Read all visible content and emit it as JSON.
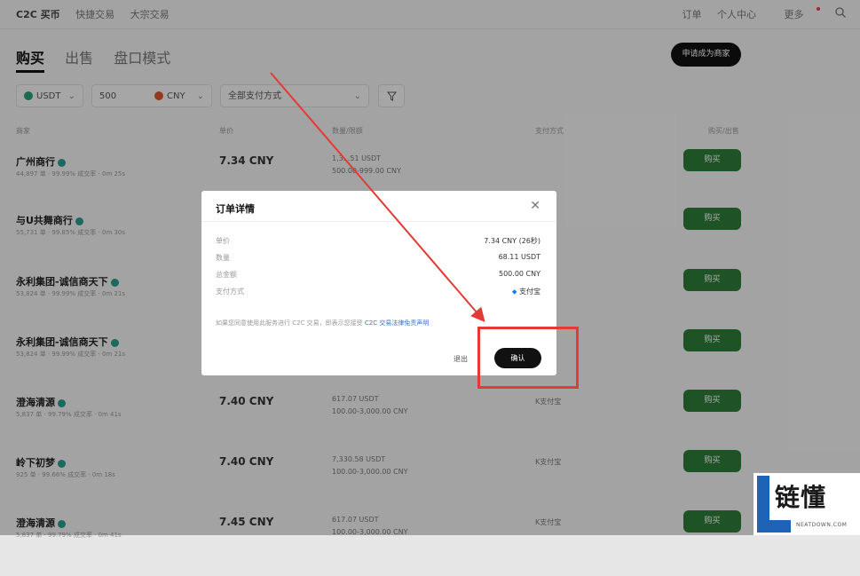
{
  "nav": {
    "brand": "C2C 买币",
    "items": [
      "快捷交易",
      "大宗交易"
    ],
    "right": [
      "订单",
      "个人中心",
      "更多"
    ]
  },
  "tabs": [
    "购买",
    "出售",
    "盘口模式"
  ],
  "merchant_button": "申请成为商家",
  "filters": {
    "coin": "USDT",
    "amount": "500",
    "fiat": "CNY",
    "payment": "全部支付方式"
  },
  "headers": [
    "商家",
    "单价",
    "数量/限额",
    "支付方式",
    "购买/出售"
  ],
  "rows": [
    {
      "name": "广州商行",
      "stats": "44,897 单 · 99.99% 成交率 · 0m 25s",
      "price": "7.34 CNY",
      "qty": "1,3...51 USDT",
      "limit": "500.00-999.00 CNY",
      "pay": "",
      "buy": "购买"
    },
    {
      "name": "与U共舞商行",
      "stats": "55,731 单 · 99.85% 成交率 · 0m 30s",
      "price": "",
      "qty": "",
      "limit": "",
      "pay": "",
      "buy": "购买"
    },
    {
      "name": "永利集团-诚信商天下",
      "stats": "53,824 单 · 99.99% 成交率 · 0m 21s",
      "price": "",
      "qty": "",
      "limit": "",
      "pay": "",
      "buy": "购买"
    },
    {
      "name": "永利集团-诚信商天下",
      "stats": "53,824 单 · 99.99% 成交率 · 0m 21s",
      "price": "",
      "qty": "",
      "limit": "",
      "pay": "",
      "buy": "购买"
    },
    {
      "name": "澄海清源",
      "stats": "5,837 单 · 99.79% 成交率 · 0m 41s",
      "price": "7.40 CNY",
      "qty": "617.07 USDT",
      "limit": "100.00-3,000.00 CNY",
      "pay": "K支付宝",
      "buy": "购买"
    },
    {
      "name": "岭下初梦",
      "stats": "925 单 · 99.66% 成交率 · 0m 18s",
      "price": "7.40 CNY",
      "qty": "7,330.58 USDT",
      "limit": "100.00-3,000.00 CNY",
      "pay": "K支付宝",
      "buy": "购买"
    },
    {
      "name": "澄海清源",
      "stats": "5,837 单 · 99.79% 成交率 · 0m 41s",
      "price": "7.45 CNY",
      "qty": "617.07 USDT",
      "limit": "100.00-3,000.00 CNY",
      "pay": "K支付宝",
      "buy": "购买"
    }
  ],
  "dialog": {
    "title": "订单详情",
    "labels": [
      "单价",
      "数量",
      "总金额",
      "支付方式"
    ],
    "values": [
      "7.34 CNY (26秒)",
      "68.11 USDT",
      "500.00 CNY",
      "支付宝"
    ],
    "note": "如果您同意使用此服务进行 C2C 交易，即表示您接受 ",
    "note_link": "C2C 交易法律免责声明",
    "cancel": "退出",
    "confirm": "确认"
  },
  "watermark": {
    "cn": "链懂",
    "en": "NEATDOWN.COM"
  },
  "colors": {
    "buy": "#2e7d3a",
    "highlight": "#e53935",
    "logo": "#1e63b5"
  }
}
